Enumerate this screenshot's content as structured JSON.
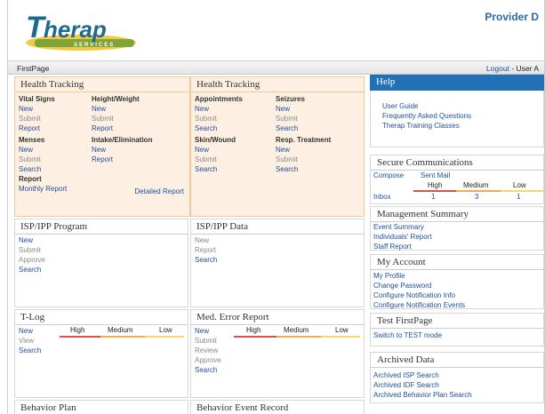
{
  "header": {
    "logo_text": "Therap",
    "logo_sub": "SERVICES",
    "provider": "Provider D"
  },
  "navbar": {
    "page": "FirstPage",
    "logout": "Logout",
    "user_sep": "- User A"
  },
  "health_tracking_1": {
    "title": "Health Tracking",
    "vital_signs": {
      "heading": "Vital Signs",
      "new": "New",
      "submit": "Submit",
      "report": "Report"
    },
    "height_weight": {
      "heading": "Height/Weight",
      "new": "New",
      "submit": "Submit",
      "report": "Report"
    },
    "menses": {
      "heading": "Menses",
      "new": "New",
      "submit": "Submit",
      "search": "Search"
    },
    "intake": {
      "heading": "Intake/Elimination",
      "new": "New",
      "report": "Report"
    },
    "report": {
      "heading": "Report",
      "monthly": "Monthly Report",
      "detailed": "Detailed Report"
    }
  },
  "health_tracking_2": {
    "title": "Health Tracking",
    "appointments": {
      "heading": "Appointments",
      "new": "New",
      "submit": "Submit",
      "search": "Search"
    },
    "seizures": {
      "heading": "Seizures",
      "new": "New",
      "submit": "Submit",
      "search": "Search"
    },
    "skin": {
      "heading": "Skin/Wound",
      "new": "New",
      "submit": "Submit",
      "search": "Search"
    },
    "resp": {
      "heading": "Resp. Treatment",
      "new": "New",
      "submit": "Submit",
      "search": "Search"
    }
  },
  "isp_program": {
    "title": "ISP/IPP Program",
    "new": "New",
    "submit": "Submit",
    "approve": "Approve",
    "search": "Search"
  },
  "isp_data": {
    "title": "ISP/IPP Data",
    "new": "New",
    "report": "Report",
    "search": "Search"
  },
  "tlog": {
    "title": "T-Log",
    "new": "New",
    "view": "View",
    "search": "Search",
    "high": "High",
    "medium": "Medium",
    "low": "Low"
  },
  "med_error": {
    "title": "Med. Error Report",
    "new": "New",
    "submit": "Submit",
    "review": "Review",
    "approve": "Approve",
    "search": "Search",
    "high": "High",
    "medium": "Medium",
    "low": "Low"
  },
  "behavior_plan": {
    "title": "Behavior Plan"
  },
  "behavior_event": {
    "title": "Behavior Event Record"
  },
  "help": {
    "title": "Help",
    "items": [
      "User Guide",
      "Frequently Asked Questions",
      "Therap Training Classes"
    ]
  },
  "secure_comm": {
    "title": "Secure Communications",
    "compose": "Compose",
    "sent_mail": "Sent Mail",
    "high": "High",
    "medium": "Medium",
    "low": "Low",
    "inbox": "Inbox",
    "inbox_high": "1",
    "inbox_medium": "3",
    "inbox_low": "1"
  },
  "mgmt_summary": {
    "title": "Management Summary",
    "items": [
      "Event Summary",
      "Individuals' Report",
      "Staff Report"
    ]
  },
  "my_account": {
    "title": "My Account",
    "items": [
      "My Profile",
      "Change Password",
      "Configure Notification Info",
      "Configure Notification Events"
    ]
  },
  "test_firstpage": {
    "title": "Test FirstPage",
    "link": "Switch to TEST mode"
  },
  "archived": {
    "title": "Archived Data",
    "items": [
      "Archived ISP Search",
      "Archived IDF Search",
      "Archived Behavior Plan Search"
    ]
  },
  "colors": {
    "accent": "#2270b6",
    "high": "#d9534f",
    "medium": "#f0ad4e",
    "low": "#f5d96b",
    "highlight_bg": "#fdf0e2"
  }
}
